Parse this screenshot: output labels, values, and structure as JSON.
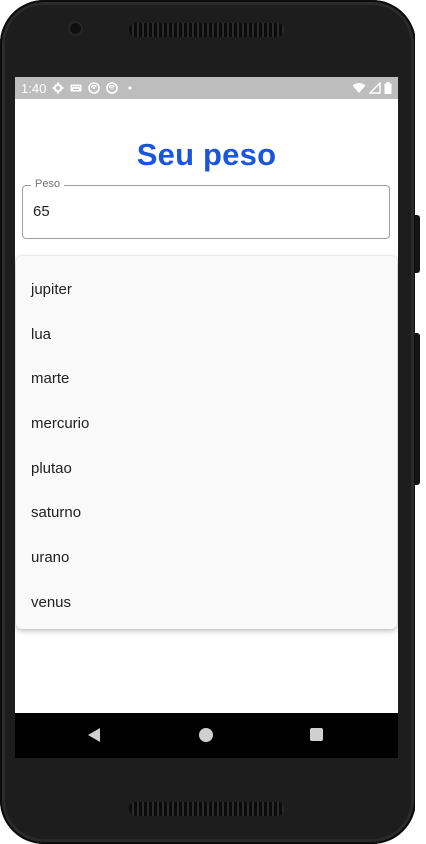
{
  "status_bar": {
    "time": "1:40",
    "icons": [
      "settings-icon",
      "keyboard-icon",
      "sync-icon",
      "sync-icon",
      "notification-dot-icon",
      "wifi-icon",
      "signal-icon",
      "battery-icon"
    ]
  },
  "app": {
    "title": "Seu peso",
    "weight_field": {
      "label": "Peso",
      "value": "65"
    },
    "dropdown": {
      "options": [
        "jupiter",
        "lua",
        "marte",
        "mercurio",
        "plutao",
        "saturno",
        "urano",
        "venus"
      ]
    }
  },
  "nav_bar": {
    "buttons": [
      "back-icon",
      "home-icon",
      "recents-icon"
    ]
  },
  "colors": {
    "title": "#1a56db",
    "status_bar": "#bdbdbd",
    "phone_body": "#1d1d1d"
  }
}
